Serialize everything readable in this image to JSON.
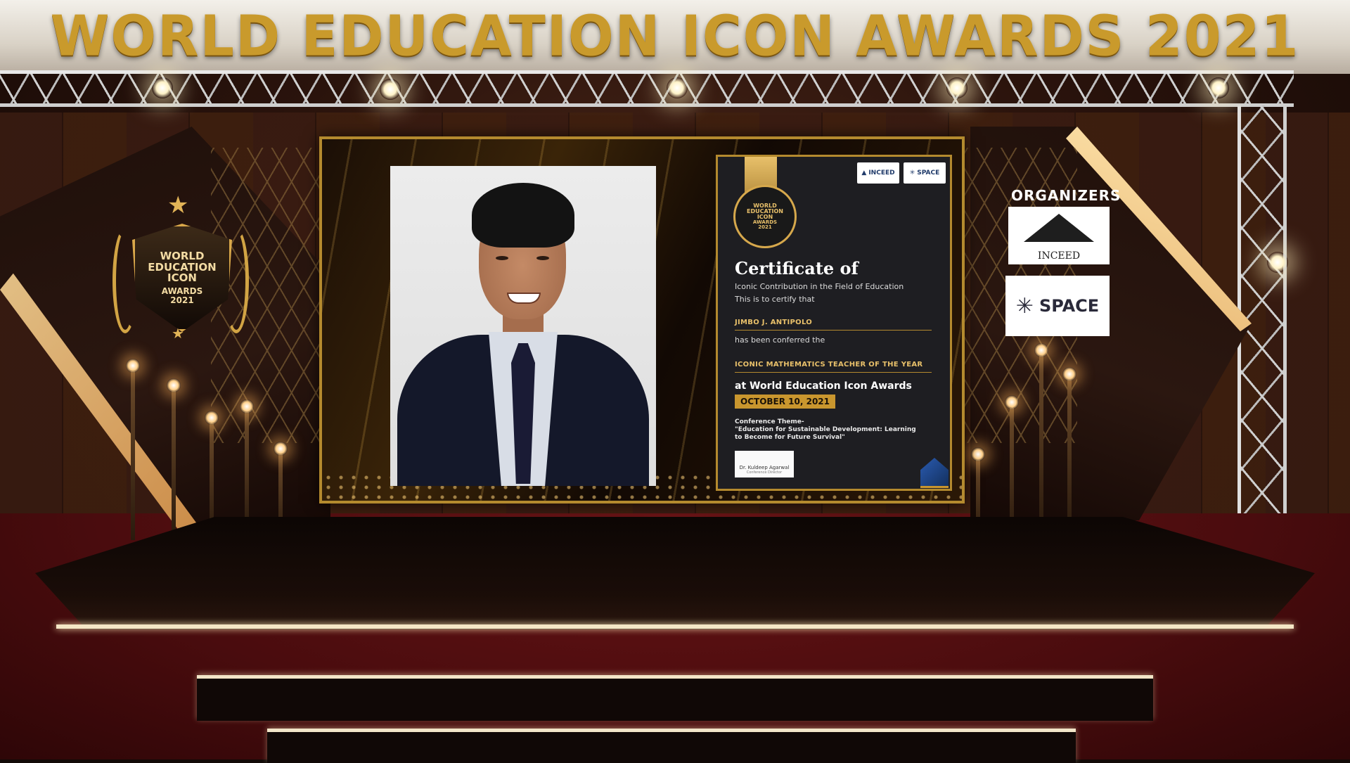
{
  "event": {
    "title": "WORLD EDUCATION ICON AWARDS 2021"
  },
  "emblem": {
    "line1": "WORLD",
    "line2": "EDUCATION",
    "line3": "ICON",
    "line4": "AWARDS",
    "line5": "2021"
  },
  "organizers": {
    "heading": "ORGANIZERS",
    "inceed_name": "INCEED",
    "space_name": "SPACE"
  },
  "certificate": {
    "logo_inceed": "INCEED",
    "logo_space": "SPACE",
    "seal_line1": "WORLD",
    "seal_line2": "EDUCATION",
    "seal_line3": "ICON",
    "seal_line4": "AWARDS",
    "seal_line5": "2021",
    "heading": "Certificate of",
    "subheading": "Iconic Contribution in the Field of Education",
    "certify_text": "This is to certify that",
    "recipient": "JIMBO J. ANTIPOLO",
    "conferred_text": "has been conferred the",
    "award_title": "ICONIC MATHEMATICS TEACHER OF THE YEAR",
    "award_event": "at World Education Icon Awards",
    "date": "OCTOBER 10, 2021",
    "theme_label": "Conference Theme-",
    "theme_text": "\"Education for Sustainable Development: Learning to Become for Future Survival\"",
    "signatory": "Dr. Kuldeep Agarwal",
    "signatory_role": "Conference Director"
  },
  "colors": {
    "gold": "#c99a2c",
    "carpet": "#5a1012",
    "certificate_bg": "#1e1e22"
  }
}
